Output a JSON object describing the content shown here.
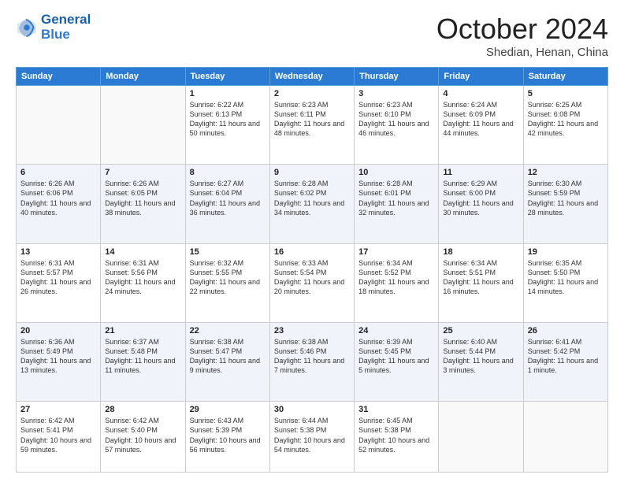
{
  "header": {
    "logo_line1": "General",
    "logo_line2": "Blue",
    "month": "October 2024",
    "location": "Shedian, Henan, China"
  },
  "weekdays": [
    "Sunday",
    "Monday",
    "Tuesday",
    "Wednesday",
    "Thursday",
    "Friday",
    "Saturday"
  ],
  "weeks": [
    [
      {
        "day": "",
        "text": ""
      },
      {
        "day": "",
        "text": ""
      },
      {
        "day": "1",
        "text": "Sunrise: 6:22 AM\nSunset: 6:13 PM\nDaylight: 11 hours and 50 minutes."
      },
      {
        "day": "2",
        "text": "Sunrise: 6:23 AM\nSunset: 6:11 PM\nDaylight: 11 hours and 48 minutes."
      },
      {
        "day": "3",
        "text": "Sunrise: 6:23 AM\nSunset: 6:10 PM\nDaylight: 11 hours and 46 minutes."
      },
      {
        "day": "4",
        "text": "Sunrise: 6:24 AM\nSunset: 6:09 PM\nDaylight: 11 hours and 44 minutes."
      },
      {
        "day": "5",
        "text": "Sunrise: 6:25 AM\nSunset: 6:08 PM\nDaylight: 11 hours and 42 minutes."
      }
    ],
    [
      {
        "day": "6",
        "text": "Sunrise: 6:26 AM\nSunset: 6:06 PM\nDaylight: 11 hours and 40 minutes."
      },
      {
        "day": "7",
        "text": "Sunrise: 6:26 AM\nSunset: 6:05 PM\nDaylight: 11 hours and 38 minutes."
      },
      {
        "day": "8",
        "text": "Sunrise: 6:27 AM\nSunset: 6:04 PM\nDaylight: 11 hours and 36 minutes."
      },
      {
        "day": "9",
        "text": "Sunrise: 6:28 AM\nSunset: 6:02 PM\nDaylight: 11 hours and 34 minutes."
      },
      {
        "day": "10",
        "text": "Sunrise: 6:28 AM\nSunset: 6:01 PM\nDaylight: 11 hours and 32 minutes."
      },
      {
        "day": "11",
        "text": "Sunrise: 6:29 AM\nSunset: 6:00 PM\nDaylight: 11 hours and 30 minutes."
      },
      {
        "day": "12",
        "text": "Sunrise: 6:30 AM\nSunset: 5:59 PM\nDaylight: 11 hours and 28 minutes."
      }
    ],
    [
      {
        "day": "13",
        "text": "Sunrise: 6:31 AM\nSunset: 5:57 PM\nDaylight: 11 hours and 26 minutes."
      },
      {
        "day": "14",
        "text": "Sunrise: 6:31 AM\nSunset: 5:56 PM\nDaylight: 11 hours and 24 minutes."
      },
      {
        "day": "15",
        "text": "Sunrise: 6:32 AM\nSunset: 5:55 PM\nDaylight: 11 hours and 22 minutes."
      },
      {
        "day": "16",
        "text": "Sunrise: 6:33 AM\nSunset: 5:54 PM\nDaylight: 11 hours and 20 minutes."
      },
      {
        "day": "17",
        "text": "Sunrise: 6:34 AM\nSunset: 5:52 PM\nDaylight: 11 hours and 18 minutes."
      },
      {
        "day": "18",
        "text": "Sunrise: 6:34 AM\nSunset: 5:51 PM\nDaylight: 11 hours and 16 minutes."
      },
      {
        "day": "19",
        "text": "Sunrise: 6:35 AM\nSunset: 5:50 PM\nDaylight: 11 hours and 14 minutes."
      }
    ],
    [
      {
        "day": "20",
        "text": "Sunrise: 6:36 AM\nSunset: 5:49 PM\nDaylight: 11 hours and 13 minutes."
      },
      {
        "day": "21",
        "text": "Sunrise: 6:37 AM\nSunset: 5:48 PM\nDaylight: 11 hours and 11 minutes."
      },
      {
        "day": "22",
        "text": "Sunrise: 6:38 AM\nSunset: 5:47 PM\nDaylight: 11 hours and 9 minutes."
      },
      {
        "day": "23",
        "text": "Sunrise: 6:38 AM\nSunset: 5:46 PM\nDaylight: 11 hours and 7 minutes."
      },
      {
        "day": "24",
        "text": "Sunrise: 6:39 AM\nSunset: 5:45 PM\nDaylight: 11 hours and 5 minutes."
      },
      {
        "day": "25",
        "text": "Sunrise: 6:40 AM\nSunset: 5:44 PM\nDaylight: 11 hours and 3 minutes."
      },
      {
        "day": "26",
        "text": "Sunrise: 6:41 AM\nSunset: 5:42 PM\nDaylight: 11 hours and 1 minute."
      }
    ],
    [
      {
        "day": "27",
        "text": "Sunrise: 6:42 AM\nSunset: 5:41 PM\nDaylight: 10 hours and 59 minutes."
      },
      {
        "day": "28",
        "text": "Sunrise: 6:42 AM\nSunset: 5:40 PM\nDaylight: 10 hours and 57 minutes."
      },
      {
        "day": "29",
        "text": "Sunrise: 6:43 AM\nSunset: 5:39 PM\nDaylight: 10 hours and 56 minutes."
      },
      {
        "day": "30",
        "text": "Sunrise: 6:44 AM\nSunset: 5:38 PM\nDaylight: 10 hours and 54 minutes."
      },
      {
        "day": "31",
        "text": "Sunrise: 6:45 AM\nSunset: 5:38 PM\nDaylight: 10 hours and 52 minutes."
      },
      {
        "day": "",
        "text": ""
      },
      {
        "day": "",
        "text": ""
      }
    ]
  ]
}
